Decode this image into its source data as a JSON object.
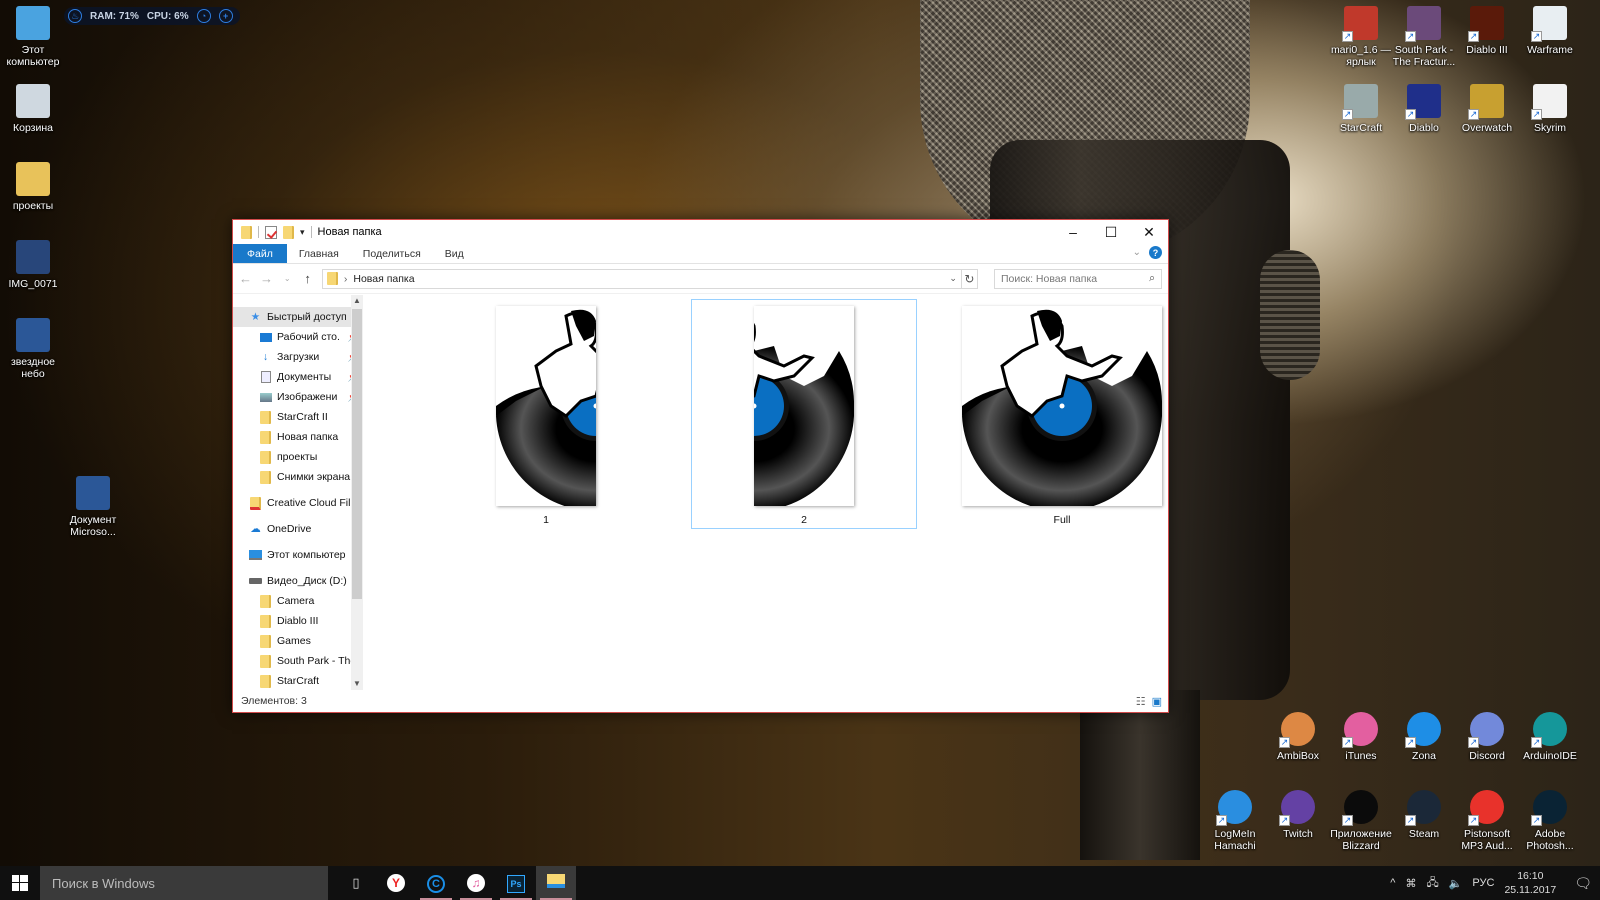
{
  "system_monitor": {
    "ram": "RAM: 71%",
    "cpu": "CPU: 6%"
  },
  "desktop_left": [
    {
      "label": "Этот компьютер",
      "icon": "computer-icon"
    },
    {
      "label": "Корзина",
      "icon": "recycle-bin-icon"
    },
    {
      "label": "проекты",
      "icon": "folder-icon"
    },
    {
      "label": "IMG_0071",
      "icon": "image-icon"
    },
    {
      "label": "звездное небо",
      "icon": "word-document-icon"
    },
    {
      "label": "Документ Microso...",
      "icon": "word-document-icon"
    }
  ],
  "desktop_right_top": [
    {
      "label": "mari0_1.6 — ярлык",
      "icon": "mario-icon"
    },
    {
      "label": "South Park - The Fractur...",
      "icon": "south-park-icon"
    },
    {
      "label": "Diablo III",
      "icon": "diablo-iii-icon"
    },
    {
      "label": "Warframe",
      "icon": "warframe-icon"
    },
    {
      "label": "StarCraft",
      "icon": "starcraft-icon"
    },
    {
      "label": "Diablo",
      "icon": "diablo-icon"
    },
    {
      "label": "Overwatch",
      "icon": "overwatch-icon"
    },
    {
      "label": "Skyrim",
      "icon": "skyrim-icon"
    }
  ],
  "desktop_right_bottom": [
    {
      "label": "AmbiBox",
      "icon": "ambibox-icon",
      "color": "#d84"
    },
    {
      "label": "iTunes",
      "icon": "itunes-icon",
      "color": "#e35fa0"
    },
    {
      "label": "Zona",
      "icon": "zona-icon",
      "color": "#1e8ee6"
    },
    {
      "label": "Discord",
      "icon": "discord-icon",
      "color": "#7289da"
    },
    {
      "label": "ArduinoIDE",
      "icon": "arduino-icon",
      "color": "#15979a"
    },
    {
      "label": "LogMeIn Hamachi",
      "icon": "hamachi-icon",
      "color": "#2a8ee0"
    },
    {
      "label": "Twitch",
      "icon": "twitch-icon",
      "color": "#6441a4"
    },
    {
      "label": "Приложение Blizzard",
      "icon": "blizzard-icon",
      "color": "#0b0b0b"
    },
    {
      "label": "Steam",
      "icon": "steam-icon",
      "color": "#1b2838"
    },
    {
      "label": "Pistonsoft MP3 Aud...",
      "icon": "rec-icon",
      "color": "#e8322b"
    },
    {
      "label": "Adobe Photosh...",
      "icon": "photoshop-icon",
      "color": "#0a2334"
    }
  ],
  "explorer": {
    "title": "Новая папка",
    "ribbon_tabs": [
      "Файл",
      "Главная",
      "Поделиться",
      "Вид"
    ],
    "address": "Новая папка",
    "search_placeholder": "Поиск: Новая папка",
    "nav_items": [
      {
        "label": "Быстрый доступ",
        "icon": "star-icon",
        "selected": true,
        "indent": 0
      },
      {
        "label": "Рабочий сто.",
        "icon": "desktop-icon",
        "pinned": true,
        "indent": 1
      },
      {
        "label": "Загрузки",
        "icon": "download-icon",
        "pinned": true,
        "indent": 1
      },
      {
        "label": "Документы",
        "icon": "documents-icon",
        "pinned": true,
        "indent": 1
      },
      {
        "label": "Изображени",
        "icon": "pictures-icon",
        "pinned": true,
        "indent": 1
      },
      {
        "label": "StarCraft II",
        "icon": "folder-icon",
        "indent": 1
      },
      {
        "label": "Новая папка",
        "icon": "folder-icon",
        "indent": 1
      },
      {
        "label": "проекты",
        "icon": "folder-icon",
        "indent": 1
      },
      {
        "label": "Снимки экрана",
        "icon": "folder-icon",
        "indent": 1
      },
      {
        "label": "Creative Cloud Fil",
        "icon": "creative-cloud-icon",
        "indent": 0,
        "gap": true
      },
      {
        "label": "OneDrive",
        "icon": "onedrive-icon",
        "indent": 0,
        "gap": true
      },
      {
        "label": "Этот компьютер",
        "icon": "computer-icon",
        "indent": 0,
        "gap": true
      },
      {
        "label": "Видео_Диск (D:)",
        "icon": "drive-icon",
        "indent": 0,
        "gap": true
      },
      {
        "label": "Camera",
        "icon": "folder-icon",
        "indent": 1
      },
      {
        "label": "Diablo III",
        "icon": "folder-icon",
        "indent": 1
      },
      {
        "label": "Games",
        "icon": "folder-icon",
        "indent": 1
      },
      {
        "label": "South Park - The",
        "icon": "folder-icon",
        "indent": 1
      },
      {
        "label": "StarCraft",
        "icon": "folder-icon",
        "indent": 1
      }
    ],
    "files": [
      {
        "name": "1",
        "variant": "left-half",
        "selected": false
      },
      {
        "name": "2",
        "variant": "right-half",
        "selected": true
      },
      {
        "name": "Full",
        "variant": "full",
        "selected": false
      }
    ],
    "status": "Элементов: 3",
    "accent": "#1979ca",
    "record_label_color": "#0a6fc2"
  },
  "taskbar": {
    "search_placeholder": "Поиск в Windows",
    "apps": [
      {
        "name": "task-view",
        "icon": "task-view-icon"
      },
      {
        "name": "yandex-browser",
        "icon": "yandex-icon"
      },
      {
        "name": "ccleaner",
        "icon": "ccleaner-icon"
      },
      {
        "name": "itunes",
        "icon": "itunes-icon"
      },
      {
        "name": "photoshop",
        "icon": "photoshop-icon"
      },
      {
        "name": "file-explorer",
        "icon": "file-explorer-icon"
      }
    ],
    "language": "РУС",
    "time": "16:10",
    "date": "25.11.2017"
  }
}
